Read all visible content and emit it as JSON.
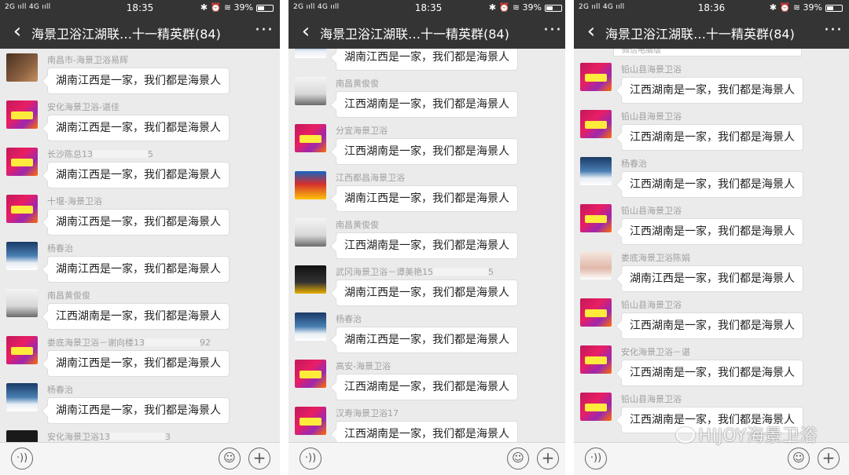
{
  "panels": [
    {
      "status": {
        "signal": "2G ııll 4G ııll",
        "time": "18:35",
        "icons": "✱ ⏰ ≋ 39%"
      },
      "title": "海景卫浴江湖联…十一精英群(84)",
      "messages": [
        {
          "sender": "南昌市-海景卫浴易辉",
          "text": "湖南江西是一家，我们都是海景人",
          "avatar": "person"
        },
        {
          "sender": "安化海景卫浴-谌佳",
          "text": "湖南江西是一家，我们都是海景人",
          "avatar": "festival"
        },
        {
          "sender": "长沙陈总13",
          "text": "湖南江西是一家，我们都是海景人",
          "avatar": "festival",
          "tail": "5"
        },
        {
          "sender": "十堰-海景卫浴",
          "text": "湖南江西是一家，我们都是海景人",
          "avatar": "festival"
        },
        {
          "sender": "杨春治",
          "text": "湖南江西是一家，我们都是海景人",
          "avatar": "sea"
        },
        {
          "sender": "南昌黄俊俊",
          "text": "江西湖南是一家，我们都是海景人",
          "avatar": "road"
        },
        {
          "sender": "娄底海景卫浴－谢向楼13",
          "text": "湖南江西是一家，我们都是海景人",
          "avatar": "festival",
          "tail": "92"
        },
        {
          "sender": "杨春治",
          "text": "湖南江西是一家，我们都是海景人",
          "avatar": "sea"
        },
        {
          "sender": "安化海景卫浴13",
          "text": "",
          "avatar": "dark",
          "tail": "3"
        }
      ]
    },
    {
      "status": {
        "signal": "2G ııll 4G ııll",
        "time": "18:35",
        "icons": "✱ ⏰ ≋ 39%"
      },
      "title": "海景卫浴江湖联…十一精英群(84)",
      "messages": [
        {
          "sender": "",
          "text": "湖南江西是一家，我们都是海景人",
          "avatar": "sea"
        },
        {
          "sender": "南昌黄俊俊",
          "text": "江西湖南是一家，我们都是海景人",
          "avatar": "road"
        },
        {
          "sender": "分宜海景卫浴",
          "text": "江西湖南是一家，我们都是海景人",
          "avatar": "festival"
        },
        {
          "sender": "江西都昌海景卫浴",
          "text": "湖南江西是一家，我们都是海景人",
          "avatar": "poster"
        },
        {
          "sender": "南昌黄俊俊",
          "text": "江西湖南是一家，我们都是海景人",
          "avatar": "road"
        },
        {
          "sender": "武冈海景卫浴－谭美艳15",
          "text": "湖南江西是一家，我们都是海景人",
          "avatar": "black",
          "tail": "5"
        },
        {
          "sender": "杨春治",
          "text": "湖南江西是一家，我们都是海景人",
          "avatar": "sea"
        },
        {
          "sender": "高安-海景卫浴",
          "text": "江西湖南是一家，我们都是海景人",
          "avatar": "festival"
        },
        {
          "sender": "汉寿海景卫浴17",
          "text": "江西湖南是一家，我们都是海景人",
          "avatar": "festival"
        }
      ]
    },
    {
      "status": {
        "signal": "2G ııll 4G ııll",
        "time": "18:36",
        "icons": "✱ ⏰ ≋ 39%"
      },
      "title": "海景卫浴江湖联…十一精英群(84)",
      "partial_top": "微信电脑版",
      "messages": [
        {
          "sender": "铅山县海景卫浴",
          "text": "江西湖南是一家，我们都是海景人",
          "avatar": "festival"
        },
        {
          "sender": "铅山县海景卫浴",
          "text": "江西湖南是一家，我们都是海景人",
          "avatar": "festival"
        },
        {
          "sender": "杨春治",
          "text": "江西湖南是一家，我们都是海景人",
          "avatar": "sea"
        },
        {
          "sender": "铅山县海景卫浴",
          "text": "江西湖南是一家，我们都是海景人",
          "avatar": "festival"
        },
        {
          "sender": "娄底海景卫浴陈娟",
          "text": "湖南江西是一家，我们都是海景人",
          "avatar": "girl"
        },
        {
          "sender": "铅山县海景卫浴",
          "text": "江西湖南是一家，我们都是海景人",
          "avatar": "festival"
        },
        {
          "sender": "安化海景卫浴－谌",
          "text": "江西湖南是一家，我们都是海景人",
          "avatar": "festival"
        },
        {
          "sender": "铅山县海景卫浴",
          "text": "江西湖南是一家，我们都是海景人",
          "avatar": "festival"
        }
      ]
    }
  ],
  "toolbar": {
    "voice_icon": "·))",
    "emoji_icon": "☺",
    "plus_icon": "+"
  },
  "watermark": "HIJOY海景卫浴",
  "colors": {
    "header_bg": "#343434",
    "chat_bg": "#ebebeb",
    "bubble_bg": "#ffffff",
    "sender_text": "#a0a0a0"
  }
}
